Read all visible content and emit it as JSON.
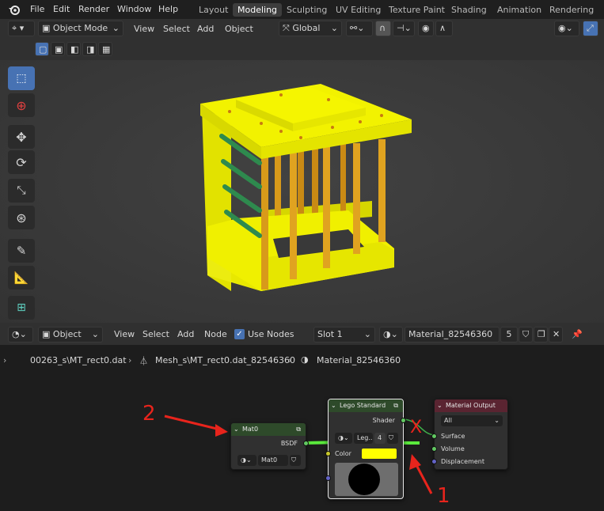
{
  "menu": {
    "items": [
      "File",
      "Edit",
      "Render",
      "Window",
      "Help"
    ],
    "workspaces": [
      "Layout",
      "Modeling",
      "Sculpting",
      "UV Editing",
      "Texture Paint",
      "Shading",
      "Animation",
      "Rendering"
    ],
    "active_workspace": "Modeling"
  },
  "viewport_header": {
    "mode": "Object Mode",
    "menus": [
      "View",
      "Select",
      "Add",
      "Object"
    ],
    "orientation": "Global"
  },
  "node_header": {
    "type": "Object",
    "menus": [
      "View",
      "Select",
      "Add",
      "Node"
    ],
    "use_nodes_label": "Use Nodes",
    "slot": "Slot 1",
    "material": "Material_82546360",
    "user_count": "5"
  },
  "breadcrumb": {
    "file": "00263_s\\MT_rect0.dat",
    "mesh": "Mesh_s\\MT_rect0.dat_82546360",
    "material": "Material_82546360"
  },
  "nodes": {
    "mat0": {
      "title": "Mat0",
      "output": "BSDF",
      "field": "Mat0"
    },
    "lego": {
      "title": "Lego Standard",
      "output": "Shader",
      "field": "Leg..",
      "field_count": "4",
      "color_label": "Color",
      "color_value": "#ffff00"
    },
    "output": {
      "title": "Material Output",
      "target": "All",
      "inputs": [
        "Surface",
        "Volume",
        "Displacement"
      ]
    }
  },
  "annotations": {
    "label_1": "1",
    "label_2": "2",
    "cross": "X"
  },
  "colors": {
    "accent": "#4772b3",
    "model_yellow": "#e8e800",
    "rod_orange": "#d89a1a",
    "rod_green": "#2e8a4e",
    "link_green": "#5aea3c",
    "annotation_red": "#e8241c"
  }
}
